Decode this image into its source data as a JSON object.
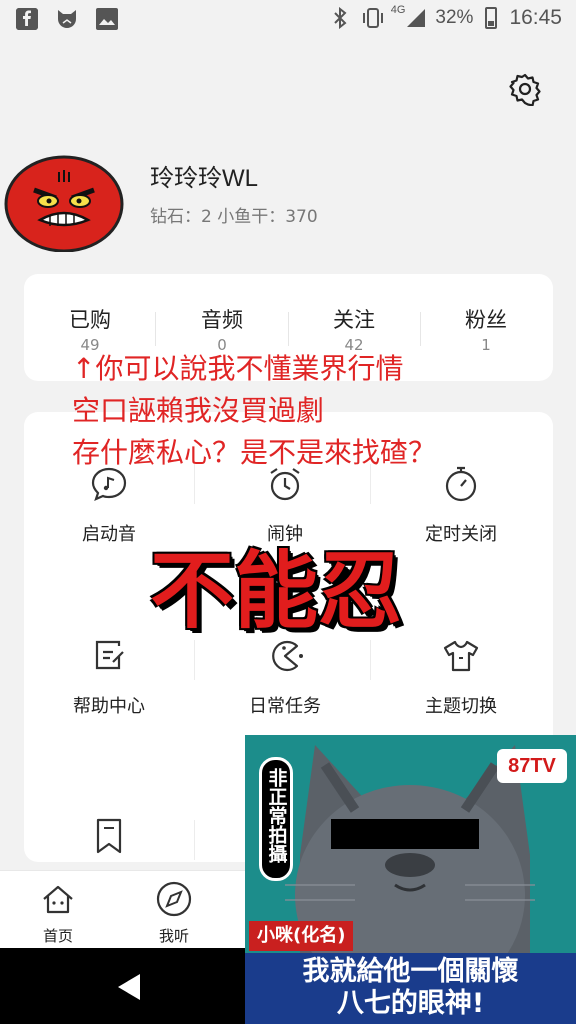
{
  "status_bar": {
    "network": "4G",
    "battery": "32%",
    "time": "16:45",
    "left_icons": [
      "facebook-icon",
      "cat-app-icon",
      "gallery-icon"
    ],
    "right_icons": [
      "bluetooth-icon",
      "vibrate-icon",
      "signal-icon",
      "battery-icon"
    ]
  },
  "profile": {
    "name": "玲玲玲WL",
    "stats_text": "钻石：2   小鱼干：370"
  },
  "stats": [
    {
      "label": "已购",
      "value": "49"
    },
    {
      "label": "音频",
      "value": "0"
    },
    {
      "label": "关注",
      "value": "42"
    },
    {
      "label": "粉丝",
      "value": "1"
    }
  ],
  "tools": [
    {
      "label": "启动音",
      "icon": "music-note-bubble-icon"
    },
    {
      "label": "闹钟",
      "icon": "alarm-clock-icon"
    },
    {
      "label": "定时关闭",
      "icon": "timer-icon"
    },
    {
      "label": "帮助中心",
      "icon": "help-doc-icon"
    },
    {
      "label": "日常任务",
      "icon": "pacman-task-icon"
    },
    {
      "label": "主题切换",
      "icon": "tshirt-icon"
    },
    {
      "label": "",
      "icon": "bookmark-icon"
    }
  ],
  "overlay": {
    "line1": "↑你可以說我不懂業界行情",
    "line2": "空口誣賴我沒買過劇",
    "line3": "存什麼私心？是不是來找碴？",
    "big": "不能忍",
    "color": "#e02525"
  },
  "bottom_nav": [
    {
      "label": "首页",
      "icon": "home-icon"
    },
    {
      "label": "我听",
      "icon": "compass-icon"
    }
  ],
  "meme": {
    "badge": "87TV",
    "vertical_label": "非正常拍攝",
    "name_tag": "小咪(化名)",
    "caption_line1": "我就給他一個關懷",
    "caption_line2": "八七的眼神!"
  }
}
